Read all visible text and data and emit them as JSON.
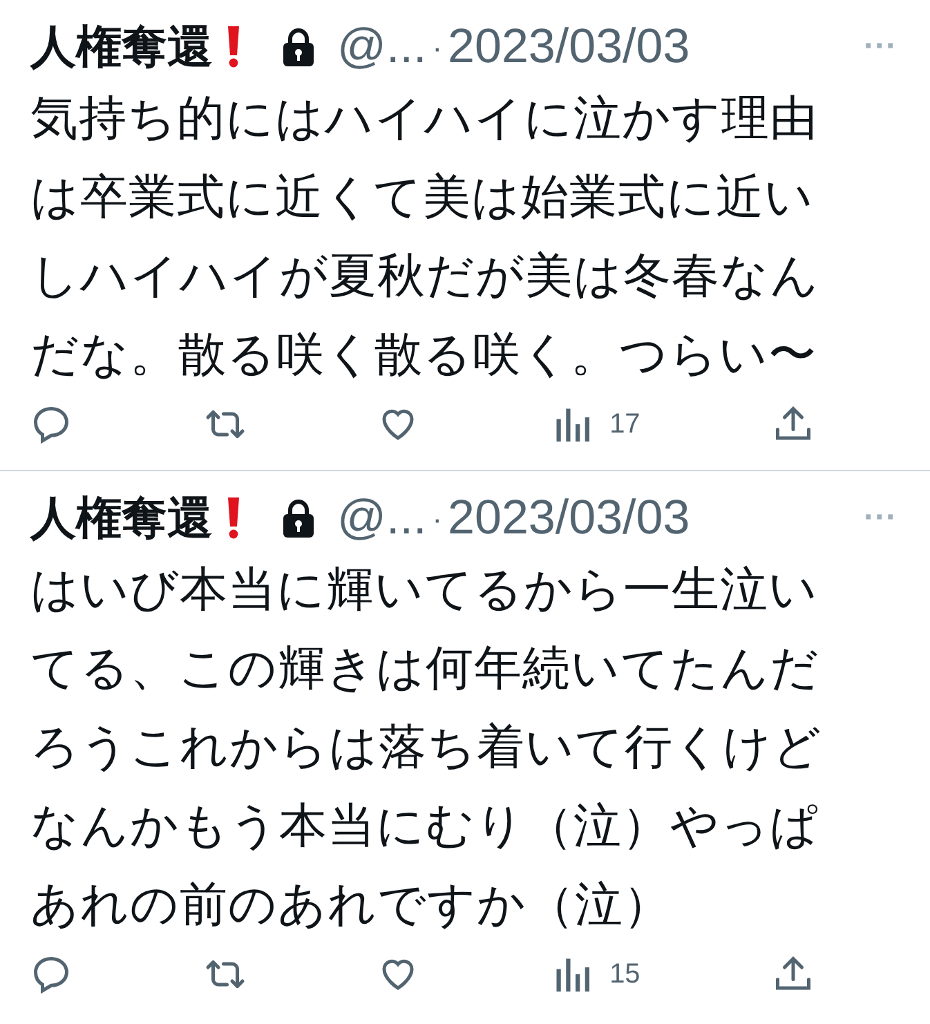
{
  "tweets": [
    {
      "name": "人権奪還",
      "handle": "@...",
      "separator": "·",
      "date": "2023/03/03",
      "more": "···",
      "text": "気持ち的にはハイハイに泣かす理由は卒業式に近くて美は始業式に近いしハイハイが夏秋だが美は冬春なんだな。散る咲く散る咲く。つらい〜",
      "views": "17"
    },
    {
      "name": "人権奪還",
      "handle": "@...",
      "separator": "·",
      "date": "2023/03/03",
      "more": "···",
      "text": "はいび本当に輝いてるから一生泣いてる、この輝きは何年続いてたんだろうこれからは落ち着いて行くけどなんかもう本当にむり（泣）やっぱあれの前のあれですか（泣）",
      "views": "15"
    }
  ]
}
